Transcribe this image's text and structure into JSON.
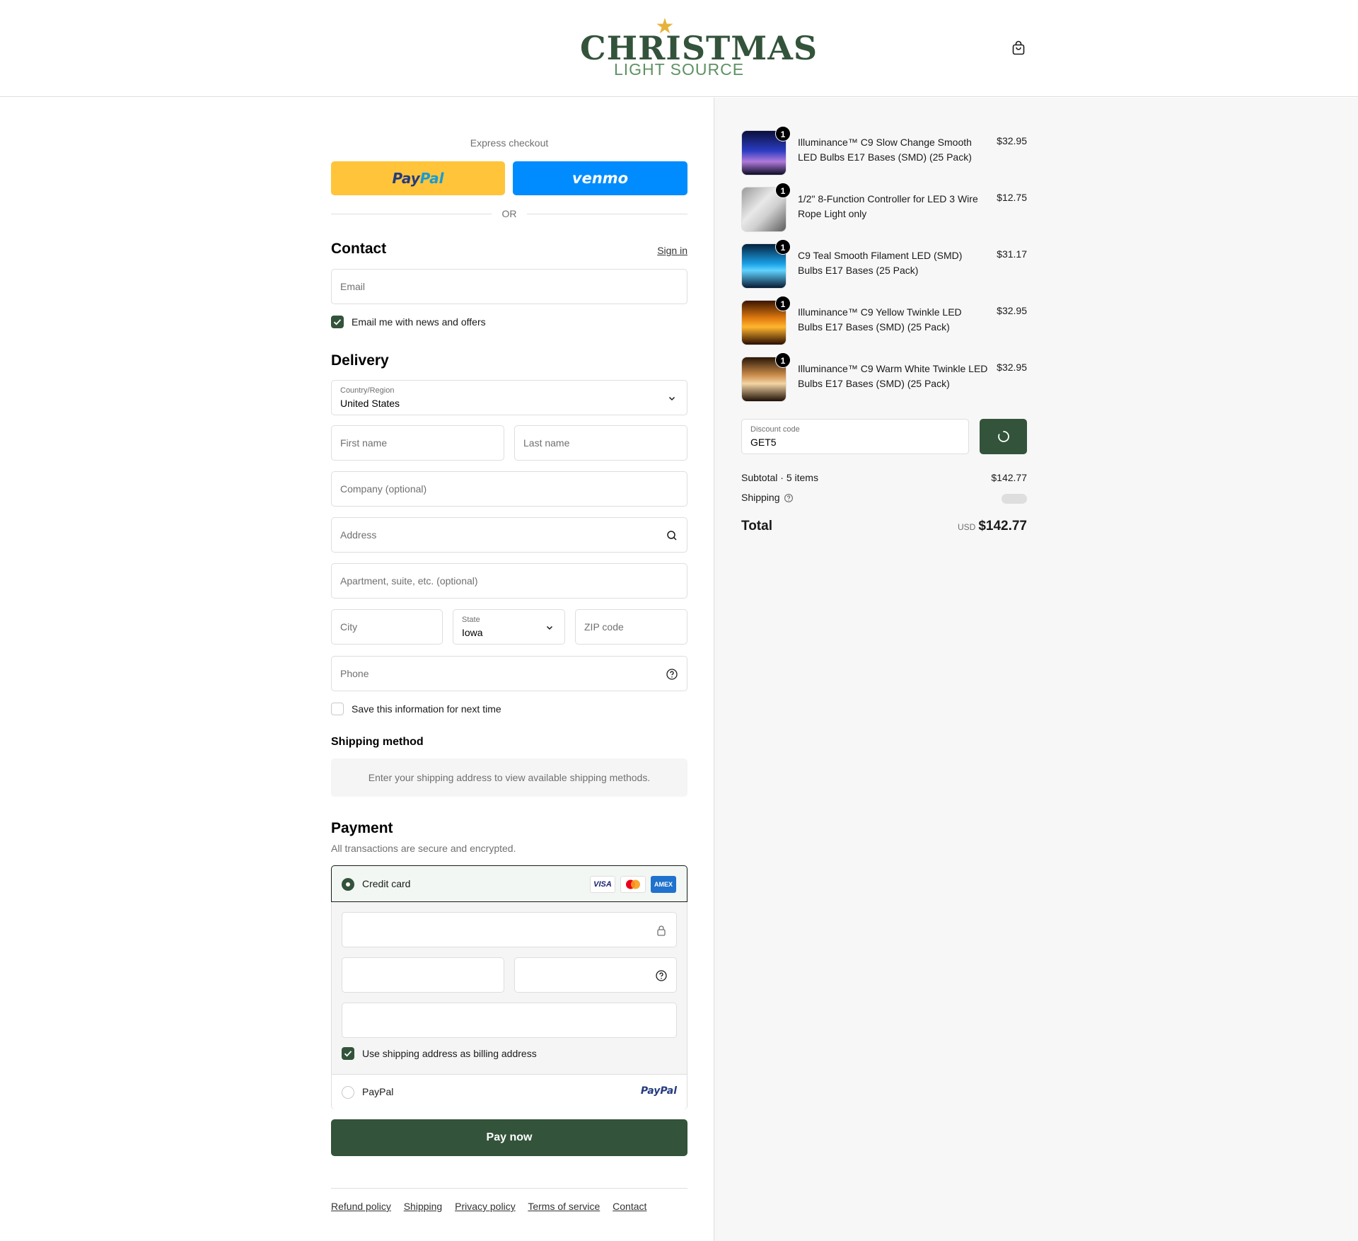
{
  "header": {
    "logo_main": "CHRISTMAS",
    "logo_sub": "LIGHT SOURCE",
    "cart_icon": "shopping-bag-icon"
  },
  "express": {
    "title": "Express checkout",
    "paypal_a": "Pay",
    "paypal_b": "Pal",
    "venmo": "venmo",
    "or": "OR"
  },
  "contact": {
    "title": "Contact",
    "sign_in": "Sign in",
    "email_placeholder": "Email",
    "news_label": "Email me with news and offers",
    "news_checked": true
  },
  "delivery": {
    "title": "Delivery",
    "country_label": "Country/Region",
    "country_value": "United States",
    "first_name": "First name",
    "last_name": "Last name",
    "company": "Company (optional)",
    "address": "Address",
    "apartment": "Apartment, suite, etc. (optional)",
    "city": "City",
    "state_label": "State",
    "state_value": "Iowa",
    "zip": "ZIP code",
    "phone": "Phone",
    "save_label": "Save this information for next time"
  },
  "shipping_method": {
    "title": "Shipping method",
    "note": "Enter your shipping address to view available shipping methods."
  },
  "payment": {
    "title": "Payment",
    "subtitle": "All transactions are secure and encrypted.",
    "credit_card": "Credit card",
    "visa": "VISA",
    "amex": "AMEX",
    "billing_label": "Use shipping address as billing address",
    "paypal_option": "PayPal",
    "paypal_logo": "PayPal",
    "pay_now": "Pay now"
  },
  "footer": {
    "links": [
      "Refund policy",
      "Shipping",
      "Privacy policy",
      "Terms of service",
      "Contact"
    ]
  },
  "order": {
    "items": [
      {
        "name": "Illuminance™ C9 Slow Change Smooth LED Bulbs E17 Bases (SMD) (25 Pack)",
        "price": "$32.95",
        "qty": "1"
      },
      {
        "name": "1/2\" 8-Function Controller for LED 3 Wire Rope Light only",
        "price": "$12.75",
        "qty": "1"
      },
      {
        "name": "C9 Teal Smooth Filament LED (SMD) Bulbs E17 Bases (25 Pack)",
        "price": "$31.17",
        "qty": "1"
      },
      {
        "name": "Illuminance™ C9 Yellow Twinkle LED Bulbs E17 Bases (SMD) (25 Pack)",
        "price": "$32.95",
        "qty": "1"
      },
      {
        "name": "Illuminance™ C9 Warm White Twinkle LED Bulbs E17 Bases (SMD) (25 Pack)",
        "price": "$32.95",
        "qty": "1"
      }
    ],
    "discount_label": "Discount code",
    "discount_value": "GET5",
    "subtotal_label": "Subtotal · 5 items",
    "subtotal_value": "$142.77",
    "shipping_label": "Shipping",
    "total_label": "Total",
    "currency": "USD",
    "total_value": "$142.77"
  },
  "colors": {
    "brand": "#33533b",
    "brand_light": "#5e9164",
    "paypal_yellow": "#ffc439",
    "venmo_blue": "#008cff"
  }
}
